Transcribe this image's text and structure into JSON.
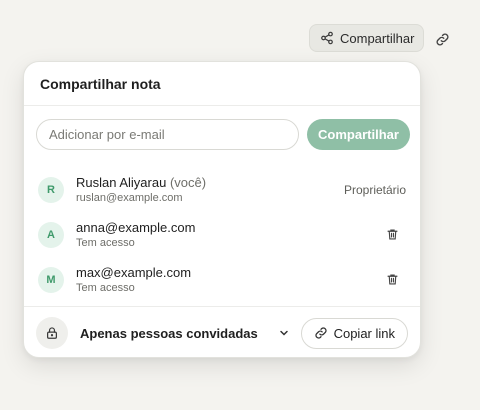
{
  "toolbar": {
    "share_label": "Compartilhar",
    "share_icon": "share-icon",
    "link_icon": "link-icon"
  },
  "dialog": {
    "title": "Compartilhar nota",
    "invite": {
      "placeholder": "Adicionar por e-mail",
      "value": "",
      "button_label": "Compartilhar"
    },
    "members": [
      {
        "initial": "R",
        "name": "Ruslan Aliyarau",
        "you_tag": "(você)",
        "sub": "ruslan@example.com",
        "role": "Proprietário"
      },
      {
        "initial": "A",
        "name": "anna@example.com",
        "you_tag": "",
        "sub": "Tem acesso",
        "role": ""
      },
      {
        "initial": "M",
        "name": "max@example.com",
        "you_tag": "",
        "sub": "Tem acesso",
        "role": ""
      }
    ],
    "footer": {
      "access_label": "Apenas pessoas convidadas",
      "copy_link_label": "Copiar link"
    }
  },
  "colors": {
    "accent": "#8fbfa6",
    "avatar_bg": "#e4f3eb",
    "avatar_text": "#3f9a6b",
    "background": "#f4f3ef"
  }
}
